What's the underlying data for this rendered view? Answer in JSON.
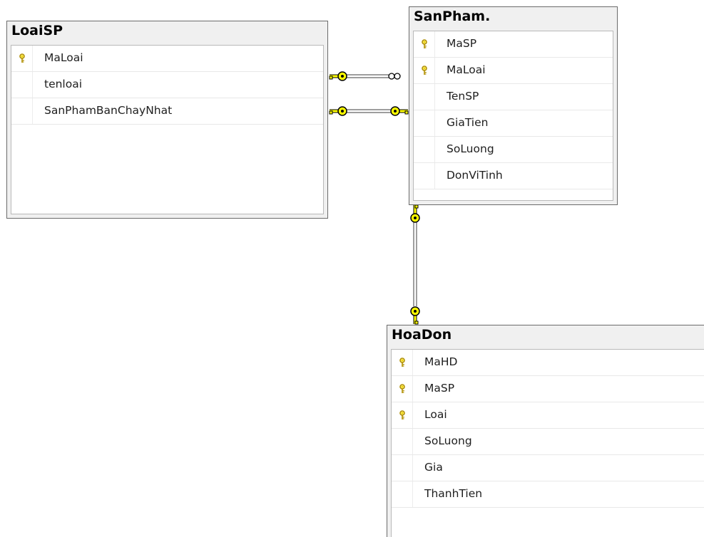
{
  "colors": {
    "background": "#ffffff",
    "table_frame": "#f0f0f0",
    "relationship_line": "#7f7f7f",
    "relationship_endpoint": "#ffff00",
    "primary_key_icon": "#d4b400"
  },
  "tables": [
    {
      "name": "LoaiSP",
      "columns": [
        {
          "name": "MaLoai",
          "primary_key": true,
          "icon": "key-icon"
        },
        {
          "name": "tenloai",
          "primary_key": false
        },
        {
          "name": "SanPhamBanChayNhat",
          "primary_key": false
        }
      ]
    },
    {
      "name": "SanPham.",
      "columns": [
        {
          "name": "MaSP",
          "primary_key": true,
          "icon": "key-icon"
        },
        {
          "name": "MaLoai",
          "primary_key": true,
          "icon": "key-icon"
        },
        {
          "name": "TenSP",
          "primary_key": false
        },
        {
          "name": "GiaTien",
          "primary_key": false
        },
        {
          "name": "SoLuong",
          "primary_key": false
        },
        {
          "name": "DonViTinh",
          "primary_key": false
        }
      ]
    },
    {
      "name": "HoaDon",
      "columns": [
        {
          "name": "MaHD",
          "primary_key": true,
          "icon": "key-icon"
        },
        {
          "name": "MaSP",
          "primary_key": true,
          "icon": "key-icon"
        },
        {
          "name": "Loai",
          "primary_key": true,
          "icon": "key-icon"
        },
        {
          "name": "SoLuong",
          "primary_key": false
        },
        {
          "name": "Gia",
          "primary_key": false
        },
        {
          "name": "ThanhTien",
          "primary_key": false
        }
      ]
    }
  ],
  "relationships": [
    {
      "from": "LoaiSP",
      "to": "SanPham.",
      "from_end": "key-icon",
      "to_end": "infinity-icon"
    },
    {
      "from": "LoaiSP",
      "to": "SanPham.",
      "from_end": "key-icon",
      "to_end": "key-icon"
    },
    {
      "from": "SanPham.",
      "to": "HoaDon",
      "from_end": "key-icon",
      "to_end": "key-icon"
    }
  ]
}
